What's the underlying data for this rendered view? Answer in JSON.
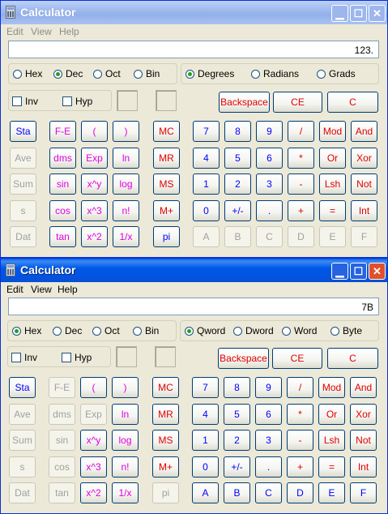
{
  "window1": {
    "title": "Calculator",
    "menu": [
      "Edit",
      "View",
      "Help"
    ],
    "display": "123.",
    "bases": [
      "Hex",
      "Dec",
      "Oct",
      "Bin"
    ],
    "selected_base": "Dec",
    "angles": [
      "Degrees",
      "Radians",
      "Grads"
    ],
    "selected_angle": "Degrees",
    "checks": [
      "Inv",
      "Hyp"
    ],
    "top_buttons": [
      "Backspace",
      "CE",
      "C"
    ],
    "stat": [
      "Sta",
      "Ave",
      "Sum",
      "s",
      "Dat"
    ],
    "funcs": [
      [
        "F-E",
        "(",
        ")"
      ],
      [
        "dms",
        "Exp",
        "ln"
      ],
      [
        "sin",
        "x^y",
        "log"
      ],
      [
        "cos",
        "x^3",
        "n!"
      ],
      [
        "tan",
        "x^2",
        "1/x"
      ]
    ],
    "memory": [
      "MC",
      "MR",
      "MS",
      "M+",
      "pi"
    ],
    "keypad": [
      [
        "7",
        "8",
        "9",
        "/",
        "Mod",
        "And"
      ],
      [
        "4",
        "5",
        "6",
        "*",
        "Or",
        "Xor"
      ],
      [
        "1",
        "2",
        "3",
        "-",
        "Lsh",
        "Not"
      ],
      [
        "0",
        "+/-",
        ".",
        "+",
        "=",
        "Int"
      ],
      [
        "A",
        "B",
        "C",
        "D",
        "E",
        "F"
      ]
    ]
  },
  "window2": {
    "title": "Calculator",
    "menu": [
      "Edit",
      "View",
      "Help"
    ],
    "display": "7B",
    "bases": [
      "Hex",
      "Dec",
      "Oct",
      "Bin"
    ],
    "selected_base": "Hex",
    "word_sizes": [
      "Qword",
      "Dword",
      "Word",
      "Byte"
    ],
    "selected_word": "Qword",
    "checks": [
      "Inv",
      "Hyp"
    ],
    "top_buttons": [
      "Backspace",
      "CE",
      "C"
    ],
    "stat": [
      "Sta",
      "Ave",
      "Sum",
      "s",
      "Dat"
    ],
    "funcs": [
      [
        "F-E",
        "(",
        ")"
      ],
      [
        "dms",
        "Exp",
        "ln"
      ],
      [
        "sin",
        "x^y",
        "log"
      ],
      [
        "cos",
        "x^3",
        "n!"
      ],
      [
        "tan",
        "x^2",
        "1/x"
      ]
    ],
    "memory": [
      "MC",
      "MR",
      "MS",
      "M+",
      "pi"
    ],
    "keypad": [
      [
        "7",
        "8",
        "9",
        "/",
        "Mod",
        "And"
      ],
      [
        "4",
        "5",
        "6",
        "*",
        "Or",
        "Xor"
      ],
      [
        "1",
        "2",
        "3",
        "-",
        "Lsh",
        "Not"
      ],
      [
        "0",
        "+/-",
        ".",
        "+",
        "=",
        "Int"
      ],
      [
        "A",
        "B",
        "C",
        "D",
        "E",
        "F"
      ]
    ]
  },
  "colors": {
    "title_active": "#0054e3",
    "title_inactive": "#9fb9ee",
    "key_blue": "#0000ff",
    "key_red": "#e00000",
    "key_magenta": "#e000e0"
  }
}
